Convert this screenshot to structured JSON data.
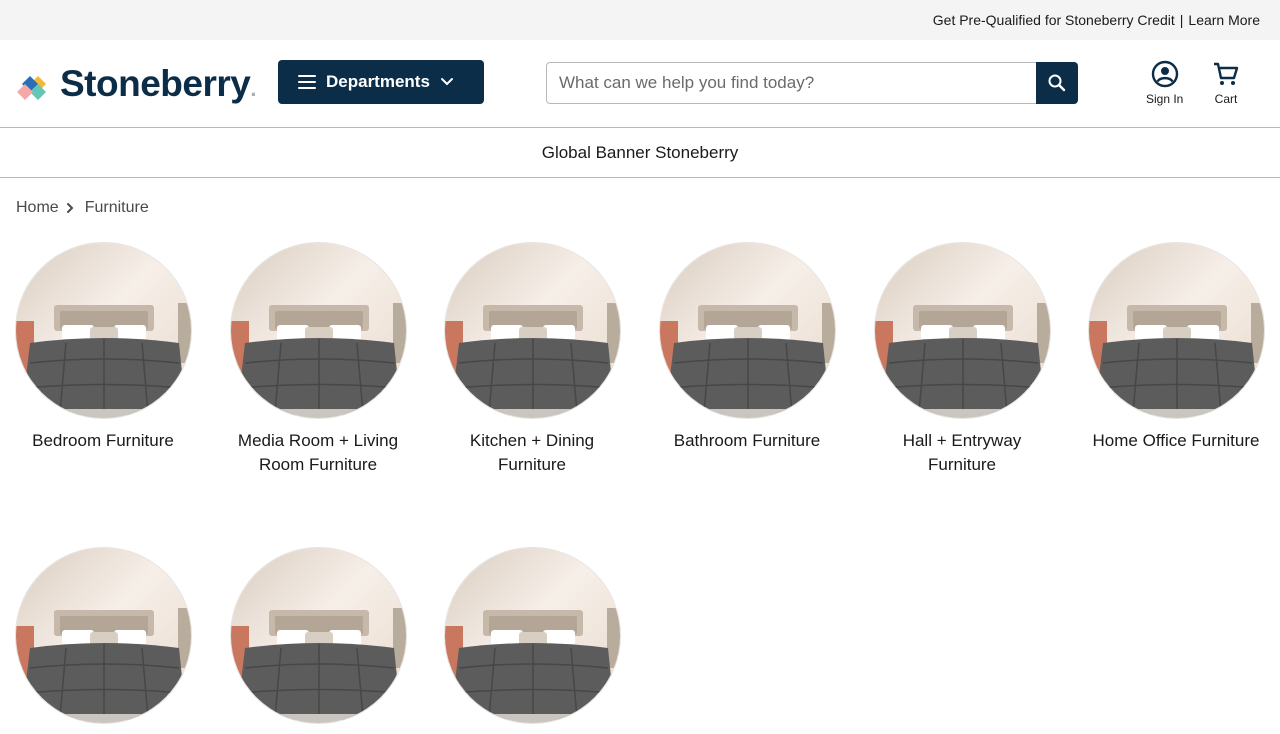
{
  "top_bar": {
    "credit_text": "Get Pre-Qualified for Stoneberry Credit",
    "separator": "|",
    "learn_more": "Learn More"
  },
  "header": {
    "logo_text": "Stoneberry",
    "logo_dot": ".",
    "departments_label": "Departments",
    "search": {
      "placeholder": "What can we help you find today?",
      "value": ""
    },
    "sign_in_label": "Sign In",
    "cart_label": "Cart"
  },
  "banner": {
    "text": "Global Banner Stoneberry"
  },
  "breadcrumb": {
    "items": [
      "Home",
      "Furniture"
    ]
  },
  "categories": [
    {
      "label": "Bedroom Furniture"
    },
    {
      "label": "Media Room + Living Room Furniture"
    },
    {
      "label": "Kitchen + Dining Furniture"
    },
    {
      "label": "Bathroom Furniture"
    },
    {
      "label": "Hall + Entryway Furniture"
    },
    {
      "label": "Home Office Furniture"
    },
    {
      "label": ""
    },
    {
      "label": ""
    },
    {
      "label": ""
    }
  ],
  "colors": {
    "brand_navy": "#0c2d48",
    "top_bar_bg": "#f4f4f4",
    "divider": "#b8b8b8"
  }
}
